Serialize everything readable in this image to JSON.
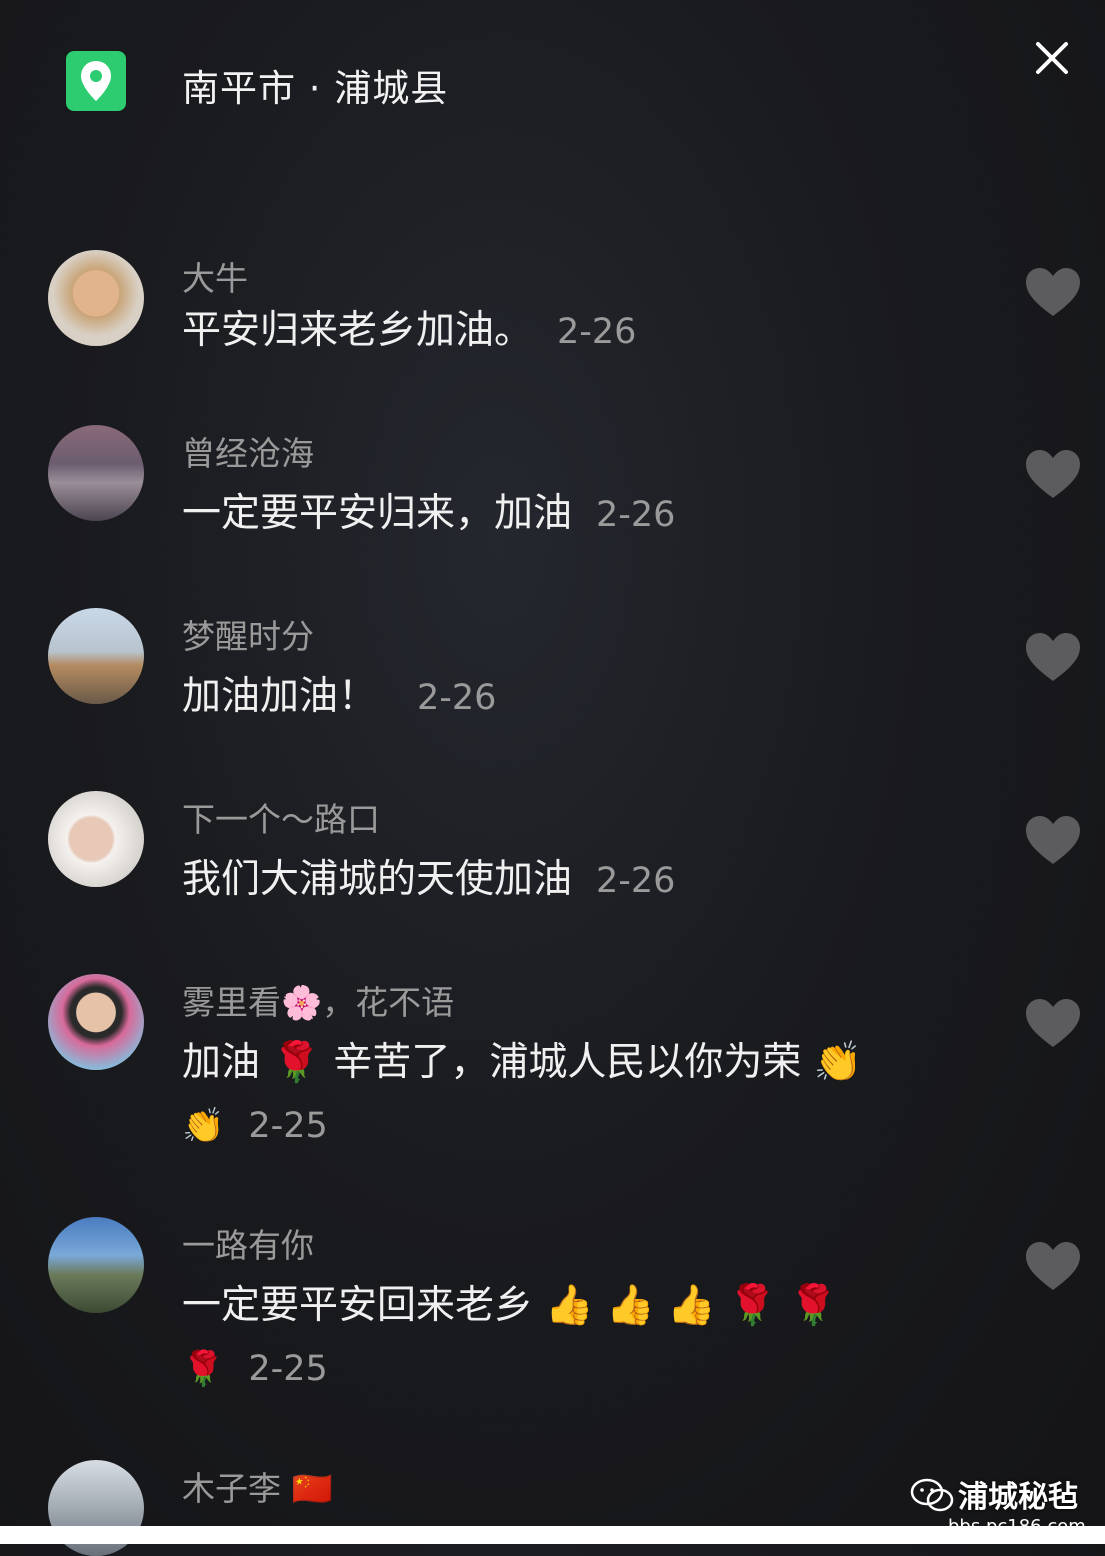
{
  "header": {
    "location": "南平市 · 浦城县",
    "accent": "#2ecc71"
  },
  "comments": [
    {
      "user": "大牛",
      "text": "平安归来老乡加油。",
      "date": "2-26"
    },
    {
      "user": "曾经沧海",
      "text": "一定要平安归来，加油",
      "date": "2-26"
    },
    {
      "user": "梦醒时分",
      "text": "加油加油！",
      "date": "2-26"
    },
    {
      "user": "下一个～路口",
      "text": "我们大浦城的天使加油",
      "date": "2-26"
    },
    {
      "user": "雾里看🌸，花不语",
      "text": "加油 🌹 辛苦了，浦城人民以你为荣 👏",
      "text2": "👏",
      "date": "2-25"
    },
    {
      "user": "一路有你",
      "text": "一定要平安回来老乡 👍 👍 👍 🌹 🌹",
      "text2": "🌹",
      "date": "2-25"
    },
    {
      "user": "木子李 🇨🇳"
    }
  ],
  "watermark": {
    "name": "浦城秘毡",
    "url": "bbs.pc186.com"
  }
}
